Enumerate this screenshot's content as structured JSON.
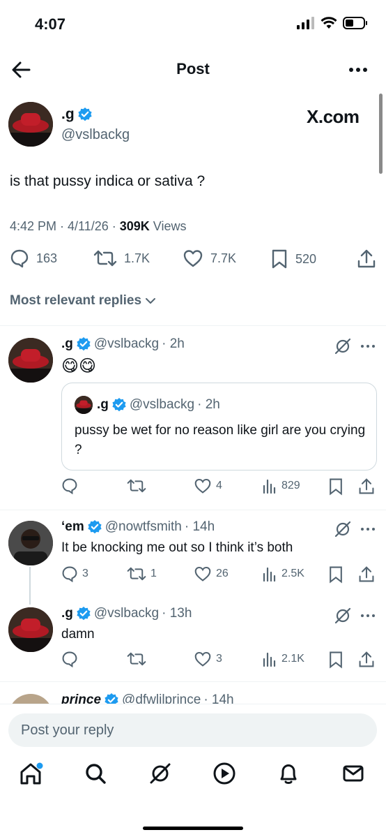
{
  "status_bar": {
    "time": "4:07"
  },
  "header": {
    "title": "Post"
  },
  "post": {
    "display_name": ".g",
    "handle": "@vslbackg",
    "source": "X.com",
    "text": "is that pussy indica or sativa ?",
    "timestamp": "4:42 PM · 4/11/26 · ",
    "views_count": "309K",
    "views_label": " Views",
    "stats": {
      "replies": "163",
      "reposts": "1.7K",
      "likes": "7.7K",
      "bookmarks": "520"
    }
  },
  "replies_filter": "Most relevant replies",
  "replies": [
    {
      "display_name": ".g",
      "handle": "@vslbackg",
      "time": "· 2h",
      "text": "😋😋",
      "quote": {
        "display_name": ".g",
        "handle": "@vslbackg",
        "time": "· 2h",
        "text": "pussy be wet for no reason like girl are you crying ?"
      },
      "stats": {
        "replies": "",
        "reposts": "",
        "likes": "4",
        "views": "829"
      }
    },
    {
      "display_name": "‘em",
      "handle": "@nowtfsmith",
      "time": "· 14h",
      "text": "It be knocking me out so I think it’s both",
      "stats": {
        "replies": "3",
        "reposts": "1",
        "likes": "26",
        "views": "2.5K"
      }
    },
    {
      "display_name": ".g",
      "handle": "@vslbackg",
      "time": "· 13h",
      "text": "damn",
      "stats": {
        "replies": "",
        "reposts": "",
        "likes": "3",
        "views": "2.1K"
      }
    },
    {
      "display_name": "prince",
      "handle": "@dfwlilprince",
      "time": "· 14h"
    }
  ],
  "composer": {
    "placeholder": "Post your reply"
  },
  "colors": {
    "accent": "#1d9bf0",
    "text": "#0f1419",
    "muted": "#536471",
    "border": "#cfd9de"
  }
}
